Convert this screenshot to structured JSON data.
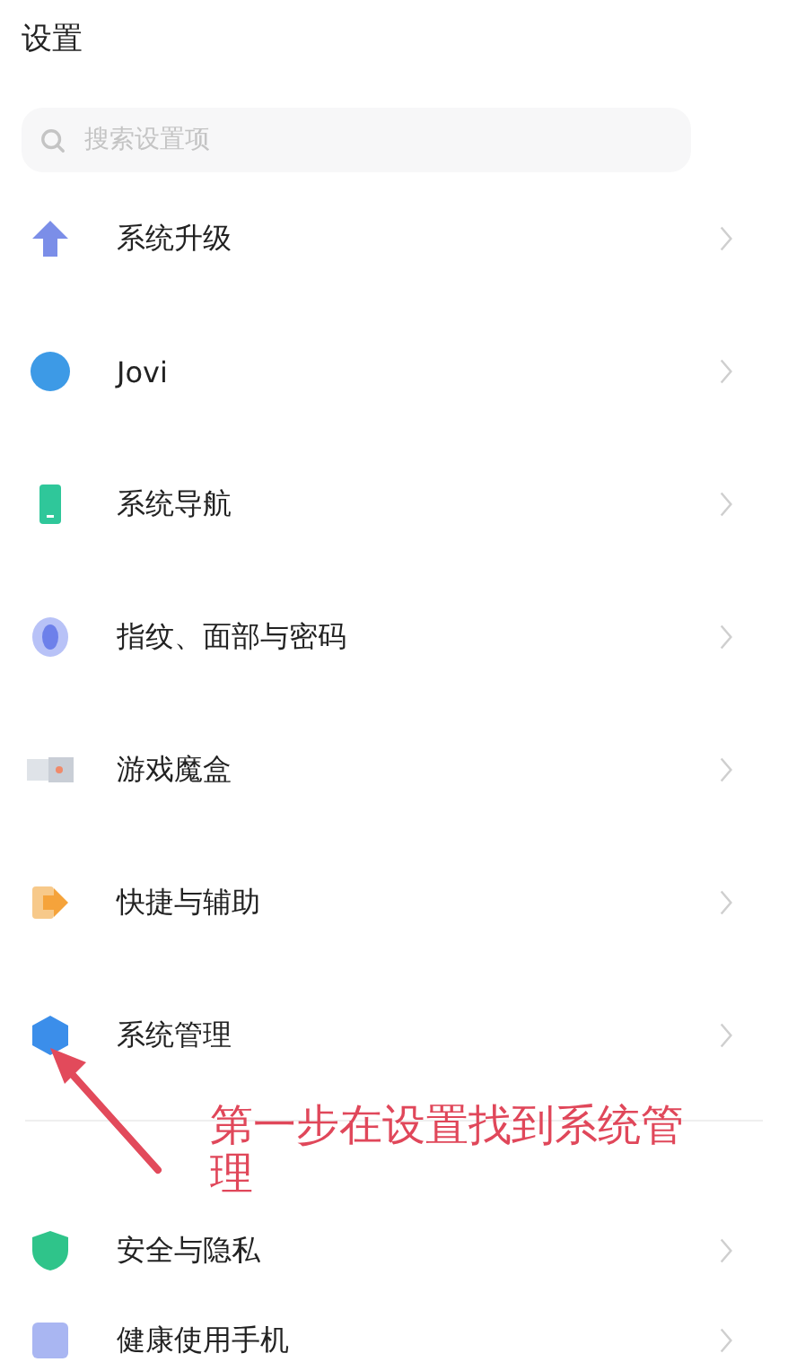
{
  "title": "设置",
  "search": {
    "placeholder": "搜索设置项"
  },
  "groups": [
    {
      "items": [
        {
          "label": "系统升级",
          "kind": "upgrade"
        },
        {
          "label": "Jovi",
          "kind": "assistant"
        },
        {
          "label": "系统导航",
          "kind": "navigation"
        },
        {
          "label": "指纹、面部与密码",
          "kind": "fingerprint"
        },
        {
          "label": "游戏魔盒",
          "kind": "game"
        },
        {
          "label": "快捷与辅助",
          "kind": "shortcut"
        },
        {
          "label": "系统管理",
          "kind": "system"
        }
      ]
    },
    {
      "items": [
        {
          "label": "安全与隐私",
          "kind": "security"
        },
        {
          "label": "健康使用手机",
          "kind": "health"
        }
      ]
    }
  ],
  "annotation": {
    "text": "第一步在设置找到系统管理"
  }
}
